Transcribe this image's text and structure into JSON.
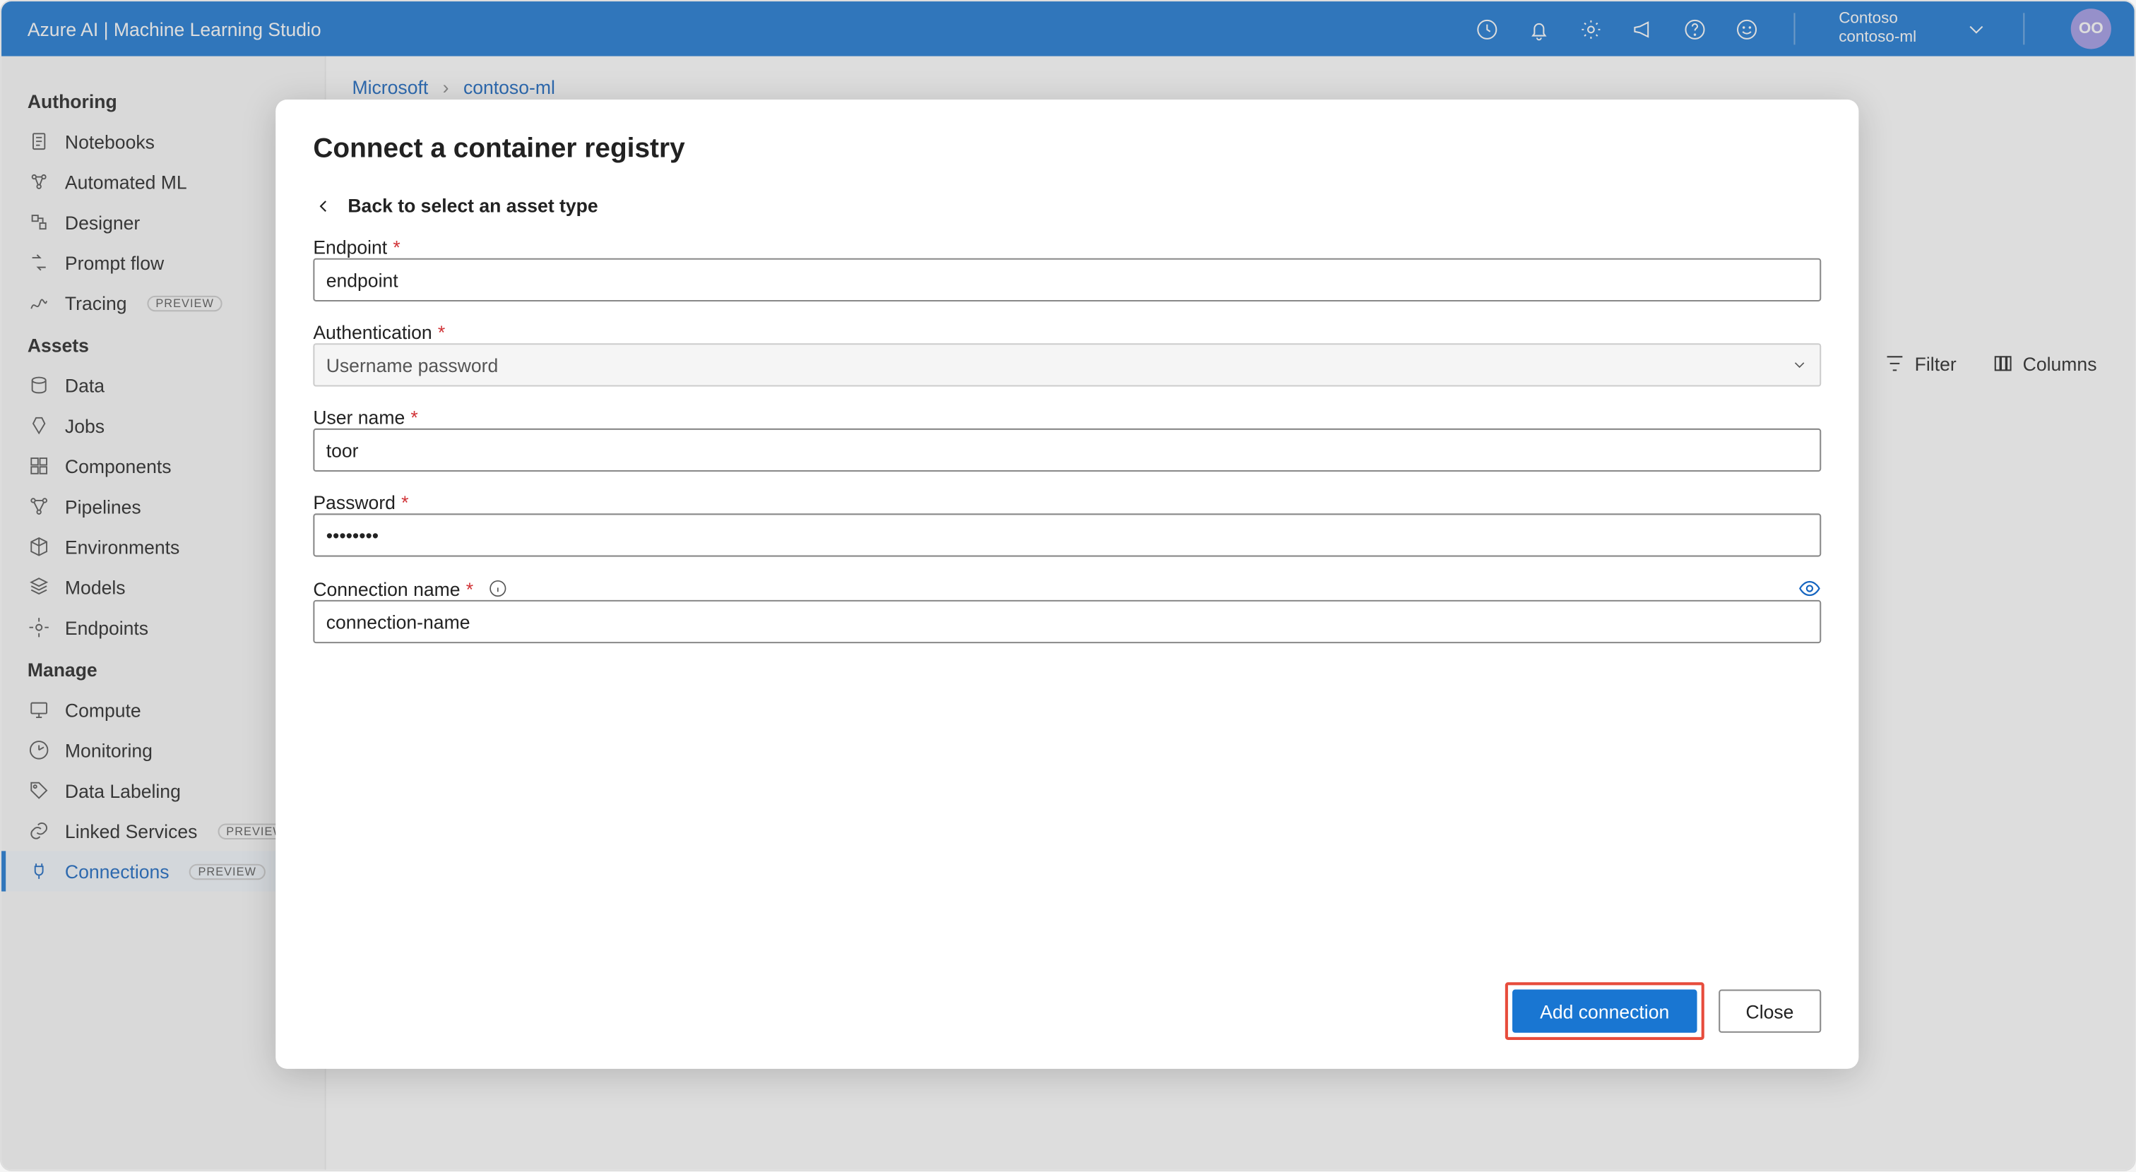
{
  "header": {
    "title": "Azure AI | Machine Learning Studio",
    "org": "Contoso",
    "workspace": "contoso-ml",
    "avatar_initials": "OO"
  },
  "breadcrumb": {
    "items": [
      "Microsoft",
      "contoso-ml"
    ]
  },
  "sidebar": {
    "sections": [
      {
        "title": "Authoring",
        "items": [
          {
            "label": "Notebooks",
            "icon": "notebook-icon"
          },
          {
            "label": "Automated ML",
            "icon": "automl-icon"
          },
          {
            "label": "Designer",
            "icon": "designer-icon"
          },
          {
            "label": "Prompt flow",
            "icon": "flow-icon"
          },
          {
            "label": "Tracing",
            "icon": "tracing-icon",
            "preview": true
          }
        ]
      },
      {
        "title": "Assets",
        "items": [
          {
            "label": "Data",
            "icon": "data-icon"
          },
          {
            "label": "Jobs",
            "icon": "jobs-icon"
          },
          {
            "label": "Components",
            "icon": "components-icon"
          },
          {
            "label": "Pipelines",
            "icon": "pipelines-icon"
          },
          {
            "label": "Environments",
            "icon": "environments-icon"
          },
          {
            "label": "Models",
            "icon": "models-icon"
          },
          {
            "label": "Endpoints",
            "icon": "endpoints-icon"
          }
        ]
      },
      {
        "title": "Manage",
        "items": [
          {
            "label": "Compute",
            "icon": "compute-icon"
          },
          {
            "label": "Monitoring",
            "icon": "monitoring-icon"
          },
          {
            "label": "Data Labeling",
            "icon": "labeling-icon"
          },
          {
            "label": "Linked Services",
            "icon": "link-icon",
            "preview": true
          },
          {
            "label": "Connections",
            "icon": "connections-icon",
            "preview": true,
            "active": true
          }
        ]
      }
    ]
  },
  "content_actions": {
    "filter": "Filter",
    "columns": "Columns"
  },
  "modal": {
    "title": "Connect a container registry",
    "back": "Back to select an asset type",
    "fields": {
      "endpoint": {
        "label": "Endpoint",
        "value": "endpoint"
      },
      "auth": {
        "label": "Authentication",
        "value": "Username password"
      },
      "username": {
        "label": "User name",
        "value": "toor"
      },
      "password": {
        "label": "Password",
        "value": "••••••••"
      },
      "conn_name": {
        "label": "Connection name",
        "value": "connection-name"
      }
    },
    "footer": {
      "primary": "Add connection",
      "secondary": "Close"
    }
  },
  "preview_badge": "PREVIEW"
}
